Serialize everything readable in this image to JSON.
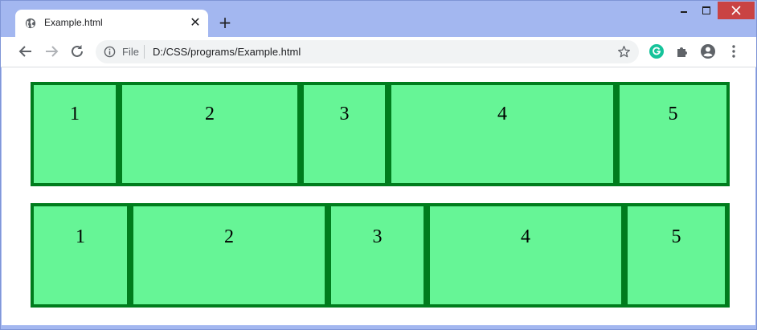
{
  "browser": {
    "tab": {
      "title": "Example.html",
      "close_label": "✕",
      "favicon": "globe-icon"
    },
    "new_tab_label": "+",
    "window_controls": {
      "minimize": "minimize-icon",
      "maximize": "maximize-icon",
      "close": "close-icon",
      "close_color": "#c94343"
    },
    "toolbar": {
      "back": "back-arrow-icon",
      "forward": "forward-arrow-icon",
      "reload": "reload-icon",
      "omnibox": {
        "scheme": "File",
        "url": "D:/CSS/programs/Example.html"
      },
      "bookmark": "star-icon",
      "extensions": [
        "grammarly-icon",
        "puzzle-icon",
        "profile-icon",
        "menu-icon"
      ]
    }
  },
  "page": {
    "colors": {
      "border": "#007c1d",
      "cell": "#66f596"
    },
    "rows": [
      {
        "cells": [
          "1",
          "2",
          "3",
          "4",
          "5"
        ]
      },
      {
        "cells": [
          "1",
          "2",
          "3",
          "4",
          "5"
        ]
      }
    ]
  }
}
